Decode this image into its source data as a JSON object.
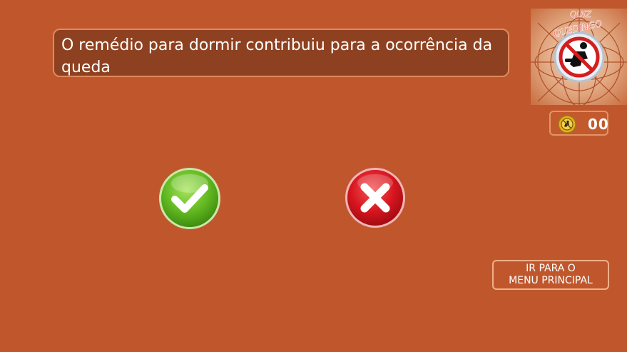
{
  "question": {
    "text": "O remédio para dormir contribuiu para a ocorrência da queda"
  },
  "logo": {
    "line1": "QUIZ",
    "line2": "QUEDINGO",
    "icon": "no-fall-icon"
  },
  "score": {
    "icon": "no-fall-coin-icon",
    "value": "00"
  },
  "answers": {
    "true_icon": "check-icon",
    "false_icon": "cross-icon"
  },
  "menu_button": {
    "line1": "IR PARA O",
    "line2": "MENU PRINCIPAL"
  },
  "colors": {
    "background": "#c0572c",
    "question_box": "#8e4120",
    "true_green": "#6bc42a",
    "false_red": "#d7151f"
  }
}
